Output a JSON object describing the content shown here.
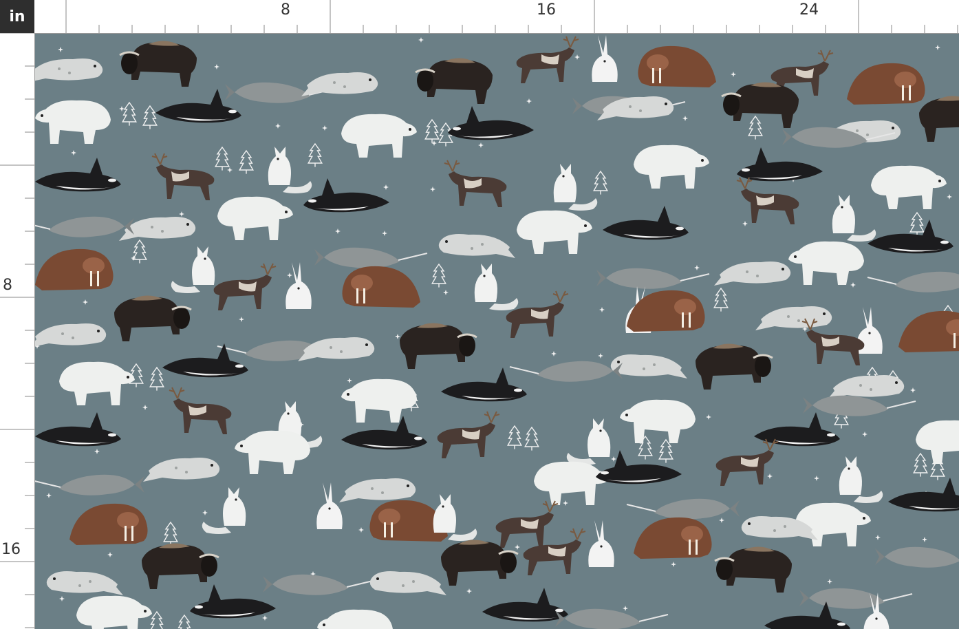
{
  "ruler": {
    "unit": "in",
    "top_labels": [
      "8",
      "16",
      "24"
    ],
    "left_labels": [
      "8",
      "16"
    ]
  },
  "fabric": {
    "background_color": "#6b7f86",
    "motif_icons": [
      "polar-bear-icon",
      "orca-icon",
      "narwhal-icon",
      "walrus-icon",
      "musk-ox-icon",
      "reindeer-icon",
      "seal-icon",
      "arctic-fox-icon",
      "arctic-hare-icon",
      "pine-tree-icon",
      "star-icon"
    ]
  }
}
